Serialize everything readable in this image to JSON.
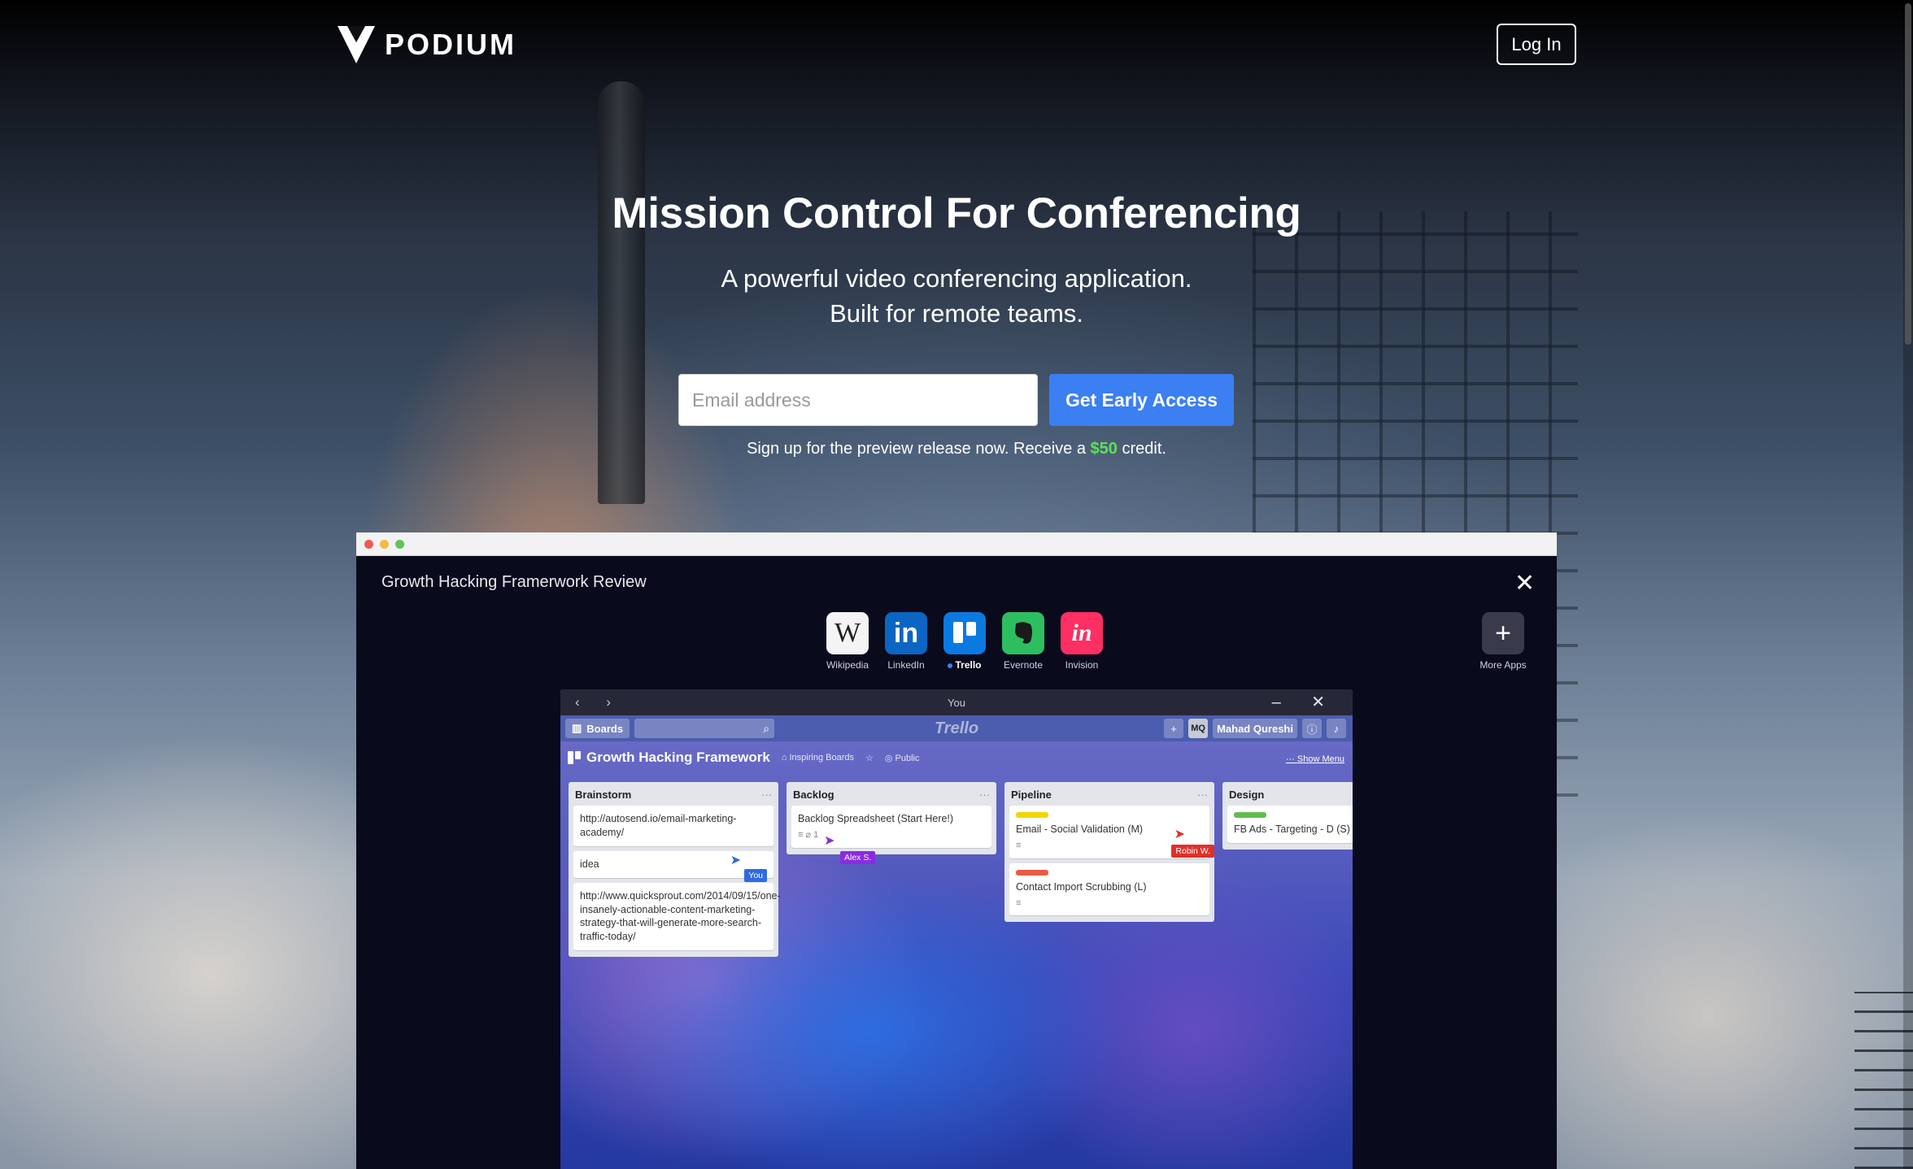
{
  "brand": {
    "name": "PODIUM"
  },
  "nav": {
    "login_label": "Log In"
  },
  "hero": {
    "headline": "Mission Control For Conferencing",
    "subline_1": "A powerful video conferencing application.",
    "subline_2": "Built for remote teams.",
    "email_placeholder": "Email address",
    "cta_label": "Get Early Access",
    "note_prefix": "Sign up for the preview release now. Receive a ",
    "note_credit": "$50",
    "note_suffix": " credit."
  },
  "colors": {
    "cta_blue": "#3b7ff3",
    "credit_green": "#5ee05a",
    "app_window_bg": "#090a1c"
  },
  "meeting": {
    "title": "Growth Hacking Framerwork Review",
    "close_icon": "close-icon",
    "apps": [
      {
        "label": "Wikipedia",
        "icon": "wikipedia-icon",
        "active": false
      },
      {
        "label": "LinkedIn",
        "icon": "linkedin-icon",
        "active": false
      },
      {
        "label": "Trello",
        "icon": "trello-icon",
        "active": true
      },
      {
        "label": "Evernote",
        "icon": "evernote-icon",
        "active": false
      },
      {
        "label": "Invision",
        "icon": "invision-icon",
        "active": false
      }
    ],
    "more_apps_label": "More Apps"
  },
  "shared_screen": {
    "window_title": "You",
    "boards_label": "Boards",
    "trello_logo": "Trello",
    "user_initials": "MQ",
    "user_name": "Mahad Qureshi",
    "board_title": "Growth Hacking Framework",
    "board_team": "Inspiring Boards",
    "board_visibility": "Public",
    "show_menu": "Show Menu",
    "lists": [
      {
        "title": "Brainstorm",
        "cards": [
          "http://autosend.io/email-marketing-academy/",
          "idea",
          "http://www.quicksprout.com/2014/09/15/one-insanely-actionable-content-marketing-strategy-that-will-generate-more-search-traffic-today/"
        ]
      },
      {
        "title": "Backlog",
        "cards": [
          "Backlog Spreadsheet (Start Here!)"
        ]
      },
      {
        "title": "Pipeline",
        "cards": [
          "Email - Social Validation (M)",
          "Contact Import Scrubbing (L)"
        ]
      },
      {
        "title": "Design",
        "cards": [
          "FB Ads - Targeting - D (S)"
        ]
      }
    ],
    "backlog_attach_count": "1",
    "cursors": {
      "you": "You",
      "alex": "Alex S.",
      "robin": "Robin W."
    }
  }
}
